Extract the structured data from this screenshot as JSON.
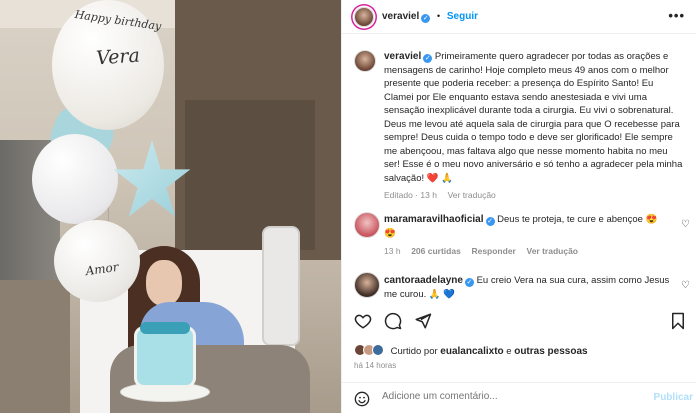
{
  "photo": {
    "balloon_top_line1": "Happy birthday",
    "balloon_top_line2": "Vera",
    "balloon_amor": "Amor"
  },
  "post": {
    "author": "veraviel",
    "follow_label": "Seguir",
    "more_label": "•••",
    "caption": "Primeiramente quero agradecer por todas as orações e mensagens de carinho! Hoje completo meus 49 anos com o melhor presente que poderia receber: a presença do Espírito Santo! Eu Clamei por Ele enquanto estava sendo anestesiada e vivi uma sensação inexplicável durante toda a cirurgia. Eu vivi o sobrenatural. Deus me levou até aquela sala de cirurgia para que O recebesse para sempre! Deus cuida o tempo todo e deve ser glorificado! Ele sempre me abençoou, mas faltava algo que nesse momento habita no meu ser! Esse é o meu novo aniversário e só tenho a agradecer pela minha salvação! ❤️ 🙏",
    "edited_label": "Editado · 13 h",
    "see_translation": "Ver tradução"
  },
  "comments": [
    {
      "user": "maramaravilhaoficial",
      "text": "Deus te proteja, te cure e abençoe 😍",
      "extra": "😍",
      "time": "13 h",
      "likes": "206 curtidas",
      "reply": "Responder",
      "translate": "Ver tradução"
    },
    {
      "user": "cantoraadelayne",
      "text": "Eu creio Vera na sua cura, assim como Jesus me curou. 🙏 💙"
    }
  ],
  "likes": {
    "prefix": "Curtido por",
    "user": "eualancalixto",
    "connector": "e",
    "others": "outras pessoas"
  },
  "timestamp": "há 14 horas",
  "add_comment": {
    "placeholder": "Adicione um comentário...",
    "publish_label": "Publicar"
  },
  "icons": {
    "heart": "heart-icon",
    "comment": "comment-icon",
    "share": "share-icon",
    "bookmark": "bookmark-icon",
    "emoji": "emoji-icon"
  },
  "colors": {
    "link_blue": "#0095f6",
    "verified_blue": "#3897f0",
    "muted": "#8e8e8e"
  }
}
